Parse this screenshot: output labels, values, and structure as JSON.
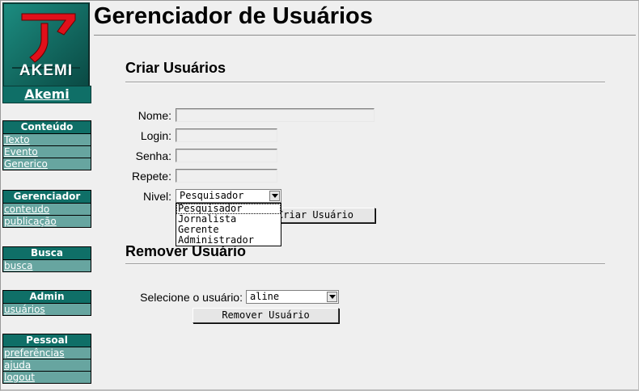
{
  "page": {
    "title": "Gerenciador de Usuários"
  },
  "brand": {
    "name": "Akemi",
    "logo_text": "AKEMI"
  },
  "sidebar": {
    "menus": [
      {
        "head": "Conteúdo",
        "items": [
          "Texto",
          "Evento",
          "Generico"
        ]
      },
      {
        "head": "Gerenciador",
        "items": [
          "conteudo",
          "publicação"
        ]
      },
      {
        "head": "Busca",
        "items": [
          "busca"
        ]
      },
      {
        "head": "Admin",
        "items": [
          "usuários"
        ]
      },
      {
        "head": "Pessoal",
        "items": [
          "preferências",
          "ajuda",
          "logout"
        ]
      }
    ]
  },
  "create": {
    "heading": "Criar Usuários",
    "labels": {
      "nome": "Nome:",
      "login": "Login:",
      "senha": "Senha:",
      "repete": "Repete:",
      "nivel": "Nivel:"
    },
    "values": {
      "nome": "",
      "login": "",
      "senha": "",
      "repete": ""
    },
    "nivel_selected": "Pesquisador",
    "nivel_options": [
      "Pesquisador",
      "Jornalista",
      "Gerente",
      "Administrador"
    ],
    "submit_label": "Criar Usuário"
  },
  "remove": {
    "heading": "Remover Usuário",
    "select_label": "Selecione o usuário:",
    "user_selected": "aline",
    "submit_label": "Remover Usuário"
  },
  "colors": {
    "menu_head": "#0f6f67",
    "menu_item": "#67a5a0",
    "background": "#efefef"
  },
  "icons": {
    "logo": "akemi-logo-icon",
    "dropdown": "chevron-down-icon"
  }
}
